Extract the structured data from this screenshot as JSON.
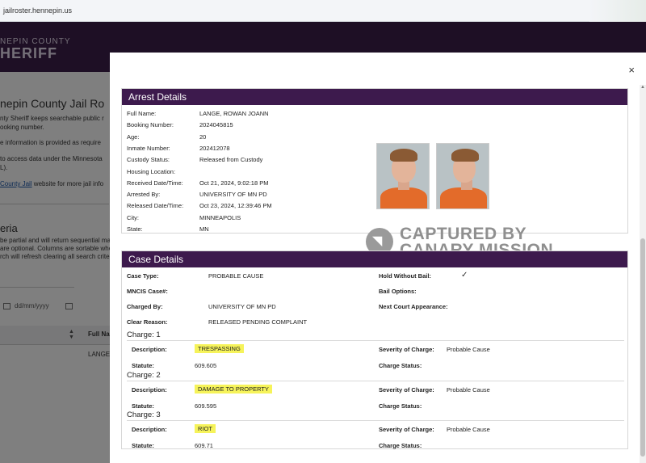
{
  "browser": {
    "url": "jailroster.hennepin.us"
  },
  "background": {
    "logo_line1": "NEPIN COUNTY",
    "logo_line2": "HERIFF",
    "heading": "nepin County Jail Ro",
    "para1_a": "nty Sheriff keeps searchable public r",
    "para1_b": "ooking number.",
    "para2": "e information is provided as require",
    "para3_a": "to access data under the Minnesota",
    "para3_b": "L).",
    "para4_link": "County Jail",
    "para4_rest": " website for more jail info",
    "criteria_heading": "eria",
    "crit1": "be partial and will return sequential ma",
    "crit2": "are optional. Columns are sortable whe",
    "crit3": "rch will refresh clearing all search criter",
    "date_placeholder": "dd/mm/yyyy",
    "col_full_name": "Full Na",
    "row_name": "LANGE"
  },
  "modal": {
    "close_label": "×",
    "arrest": {
      "title": "Arrest Details",
      "fields": [
        {
          "label": "Full Name:",
          "value": "LANGE, ROWAN JOANN"
        },
        {
          "label": "Booking Number:",
          "value": "2024045815"
        },
        {
          "label": "Age:",
          "value": "20"
        },
        {
          "label": "Inmate Number:",
          "value": "202412078"
        },
        {
          "label": "Custody Status:",
          "value": "Released from Custody"
        },
        {
          "label": "Housing Location:",
          "value": ""
        },
        {
          "label": "Received Date/Time:",
          "value": "Oct 21, 2024, 9:02:18 PM"
        },
        {
          "label": "Arrested By:",
          "value": "UNIVERSITY OF MN PD"
        },
        {
          "label": "Released Date/Time:",
          "value": "Oct 23, 2024, 12:39:46 PM"
        },
        {
          "label": "City:",
          "value": "MINNEAPOLIS"
        },
        {
          "label": "State:",
          "value": "MN"
        }
      ],
      "watermark_line1": "CAPTURED BY",
      "watermark_line2": "CANARY MISSION"
    },
    "case": {
      "title": "Case Details",
      "left": [
        {
          "label": "Case Type:",
          "value": "PROBABLE CAUSE"
        },
        {
          "label": "MNCIS Case#:",
          "value": ""
        },
        {
          "label": "Charged By:",
          "value": "UNIVERSITY OF MN PD"
        },
        {
          "label": "Clear Reason:",
          "value": "RELEASED PENDING COMPLAINT"
        }
      ],
      "right": [
        {
          "label": "Hold Without Bail:",
          "value": "✓"
        },
        {
          "label": "Bail Options:",
          "value": ""
        },
        {
          "label": "Next Court Appearance:",
          "value": ""
        }
      ],
      "charges": [
        {
          "title": "Charge: 1",
          "description": "TRESPASSING",
          "statute": "609.605",
          "severity": "Probable Cause",
          "status": ""
        },
        {
          "title": "Charge: 2",
          "description": "DAMAGE TO PROPERTY",
          "statute": "609.595",
          "severity": "Probable Cause",
          "status": ""
        },
        {
          "title": "Charge: 3",
          "description": "RIOT",
          "statute": "609.71",
          "severity": "Probable Cause",
          "status": ""
        }
      ],
      "labels": {
        "description": "Description:",
        "statute": "Statute:",
        "severity": "Severity of Charge:",
        "status": "Charge Status:"
      }
    }
  }
}
